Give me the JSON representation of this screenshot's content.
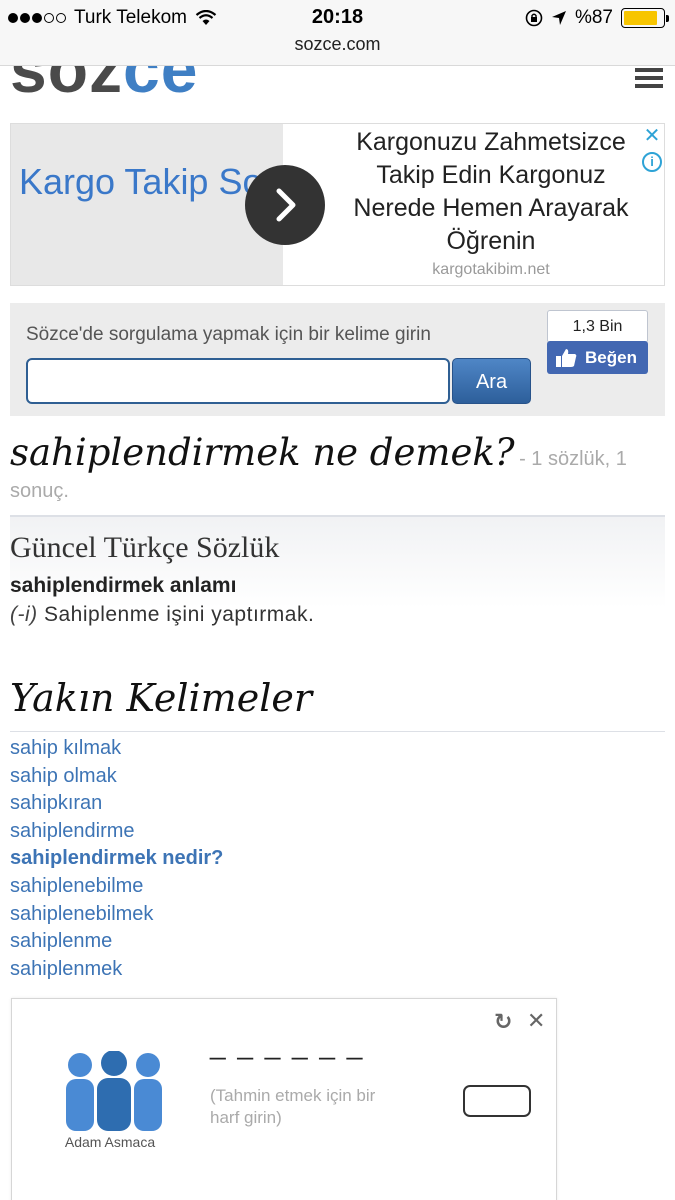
{
  "status_bar": {
    "carrier": "Turk Telekom",
    "signal_bars": 3,
    "time": "20:18",
    "battery_percent": "%87",
    "battery_level": 0.87,
    "url": "sozce.com"
  },
  "header": {
    "logo_part1": "söz",
    "logo_part2": "ce"
  },
  "ad": {
    "left_text": "Kargo Takip Sorgulama",
    "right_text": "Kargonuzu Zahmetsizce Takip Edin Kargonuz Nerede Hemen Arayarak Öğrenin",
    "domain": "kargotakibim.net",
    "arrow_icon": "chevron-right-icon",
    "close_icon": "close-icon",
    "info_icon": "info-icon"
  },
  "search": {
    "label": "Sözce'de sorgulama yapmak için bir kelime girin",
    "input_value": "",
    "button_label": "Ara"
  },
  "facebook": {
    "count": "1,3 Bin",
    "like_label": "Beğen"
  },
  "headline": {
    "title": "sahiplendirmek ne demek?",
    "subtitle": "- 1 sözlük, 1 sonuç."
  },
  "dictionary": {
    "name": "Güncel Türkçe Sözlük",
    "word_heading": "sahiplendirmek anlamı",
    "def_tag": "(-i)",
    "definition": "Sahiplenme işini yaptırmak."
  },
  "nearby": {
    "title": "Yakın Kelimeler",
    "items": [
      "sahip kılmak",
      "sahip olmak",
      "sahipkıran",
      "sahiplendirme",
      "sahiplendirmek nedir?",
      "sahiplenebilme",
      "sahiplenebilmek",
      "sahiplenme",
      "sahiplenmek"
    ],
    "active_index": 4
  },
  "hangman": {
    "caption": "Adam Asmaca",
    "dashes": "_ _ _ _ _ _",
    "hint": "(Tahmin etmek için bir harf girin)",
    "letter_value": ""
  },
  "colors": {
    "link": "#3d74b5",
    "brand_blue": "#3f7fc4",
    "facebook": "#4267b2",
    "battery": "#f7c500"
  }
}
